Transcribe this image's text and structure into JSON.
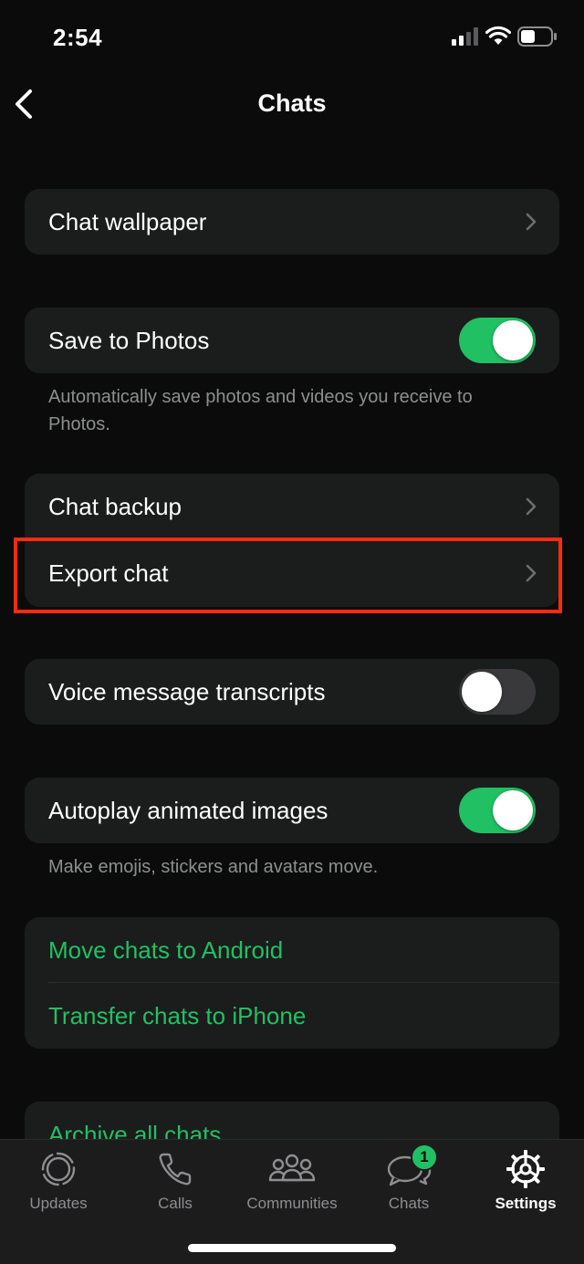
{
  "status": {
    "time": "2:54"
  },
  "nav": {
    "title": "Chats"
  },
  "groups": {
    "wallpaper": {
      "label": "Chat wallpaper"
    },
    "save_photos": {
      "label": "Save to Photos",
      "toggle": true,
      "footnote": "Automatically save photos and videos you receive to Photos."
    },
    "backup": {
      "chat_backup": "Chat backup",
      "export_chat": "Export chat"
    },
    "transcripts": {
      "label": "Voice message transcripts",
      "toggle": false
    },
    "autoplay": {
      "label": "Autoplay animated images",
      "toggle": true,
      "footnote": "Make emojis, stickers and avatars move."
    },
    "transfer": {
      "move_android": "Move chats to Android",
      "transfer_iphone": "Transfer chats to iPhone"
    },
    "archive": {
      "label": "Archive all chats"
    }
  },
  "tabs": [
    {
      "label": "Updates",
      "icon": "updates-icon"
    },
    {
      "label": "Calls",
      "icon": "phone-icon"
    },
    {
      "label": "Communities",
      "icon": "communities-icon"
    },
    {
      "label": "Chats",
      "icon": "chat-bubbles-icon",
      "badge": "1"
    },
    {
      "label": "Settings",
      "icon": "gear-icon",
      "active": true
    }
  ],
  "colors": {
    "accent": "#21c063",
    "background": "#0b0b0b",
    "cell": "#1b1c1c",
    "highlight": "#ff2a12"
  }
}
